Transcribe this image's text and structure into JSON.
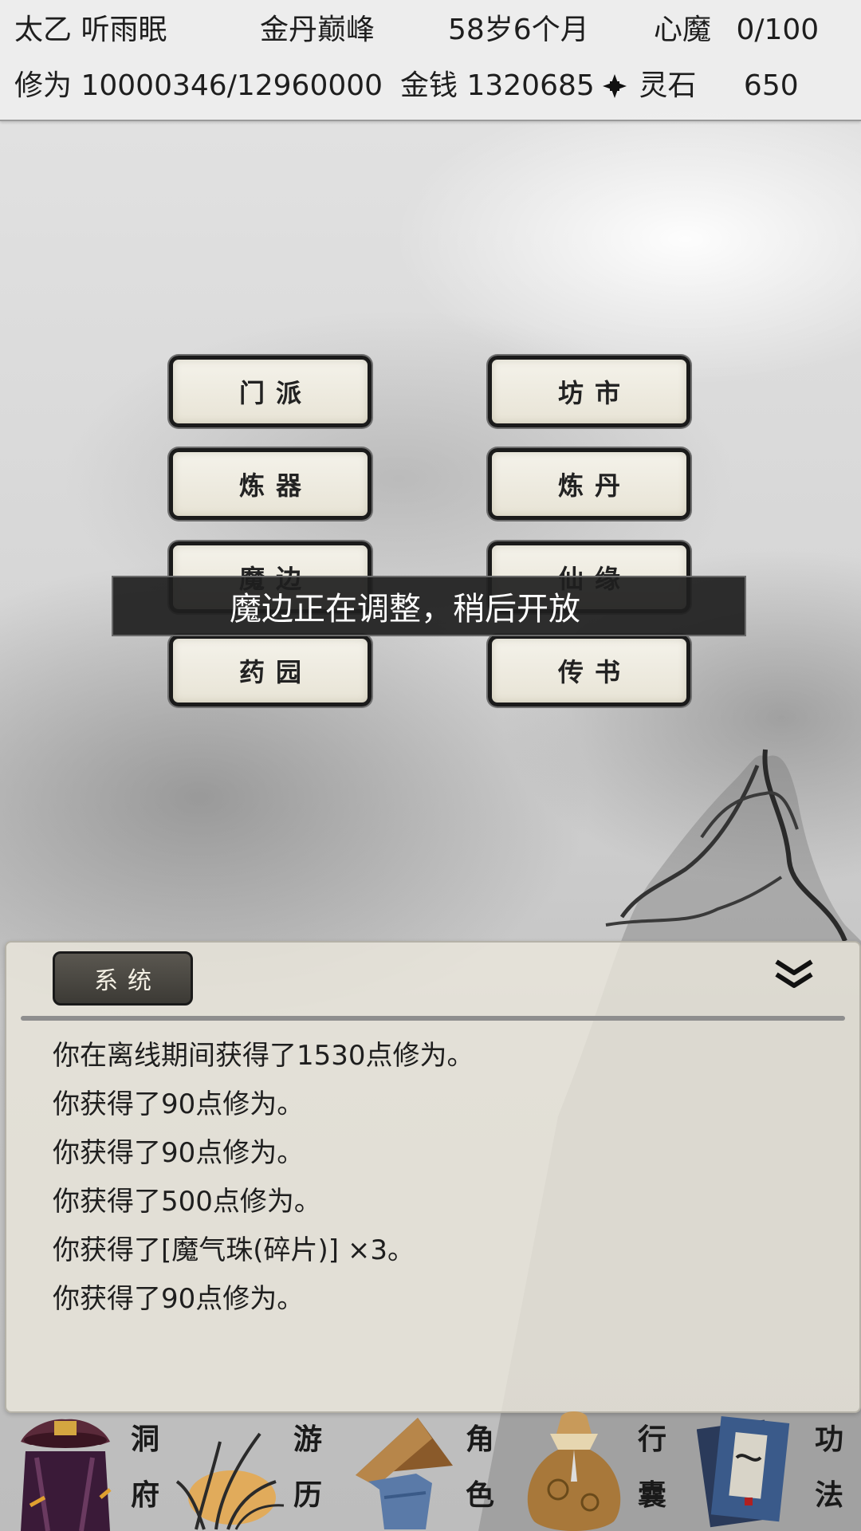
{
  "header": {
    "sect": "太乙",
    "name": "听雨眠",
    "realm": "金丹巅峰",
    "age": "58岁6个月",
    "demon_label": "心魔",
    "demon_value": "0/100",
    "cultivation_label": "修为",
    "cultivation_value": "10000346/12960000",
    "money_label": "金钱",
    "money_value": "1320685",
    "spirit_stone_label": "灵石",
    "spirit_stone_value": "650",
    "spirit_icon": "spirit-stone-icon"
  },
  "menu": {
    "sect": "门派",
    "market": "坊市",
    "forge": "炼器",
    "alchemy": "炼丹",
    "demon_border": "魔边",
    "immortal_fate": "仙缘",
    "herb_garden": "药园",
    "messenger": "传书"
  },
  "toast": "魔边正在调整，稍后开放",
  "log": {
    "tab": "系统",
    "collapse_icon": "double-chevron-down-icon",
    "entries": [
      "你在离线期间获得了1530点修为。",
      "你获得了90点修为。",
      "你获得了90点修为。",
      "你获得了500点修为。",
      "你获得了[魔气珠(碎片)] ×3。",
      "你获得了90点修为。"
    ]
  },
  "nav": [
    {
      "label": "洞府",
      "icon": "cave-dwelling-icon"
    },
    {
      "label": "游历",
      "icon": "travel-grass-icon"
    },
    {
      "label": "角色",
      "icon": "straw-hat-character-icon"
    },
    {
      "label": "行囊",
      "icon": "bag-icon"
    },
    {
      "label": "功法",
      "icon": "scripture-book-icon"
    }
  ],
  "colors": {
    "header_bg": "#eeeeee",
    "button_bg": "#f0ede3",
    "button_border": "#1a1a1a",
    "toast_bg": "#1e1e1e",
    "tab_bg": "#4a4843"
  }
}
